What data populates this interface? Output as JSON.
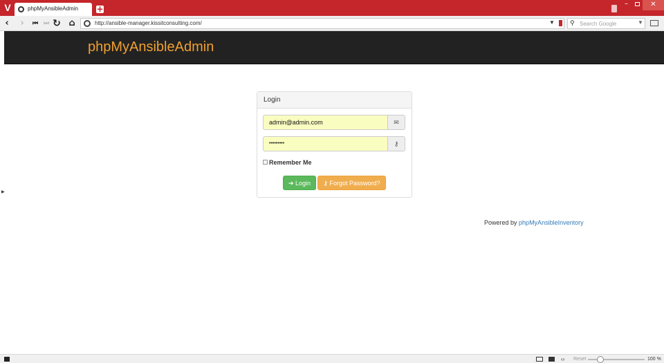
{
  "browser": {
    "tab_title": "phpMyAnsibleAdmin",
    "url": "http://ansible-manager.kissitconsulting.com/",
    "search_placeholder": "Search Google",
    "zoom_level": "100 %",
    "reset_label": "Reset"
  },
  "header": {
    "brand": "phpMyAnsibleAdmin"
  },
  "login_panel": {
    "heading": "Login",
    "email_value": "admin@admin.com",
    "password_mask": "•••••••••",
    "remember_label": "Remember Me",
    "login_button": "Login",
    "forgot_button": "Forgot Password?"
  },
  "footer": {
    "powered_prefix": "Powered by",
    "powered_link": "phpMyAnsibleInventory"
  },
  "colors": {
    "chrome_red": "#c4262b",
    "brand_orange": "#f0a030",
    "navbar": "#222222",
    "success": "#5cb85c",
    "warning": "#f0ad4e",
    "link": "#337ab7",
    "autofill": "#fafdc0"
  },
  "icons": {
    "email_addon": "envelope-icon",
    "password_addon": "key-icon",
    "login_button_icon": "sign-in-icon",
    "forgot_button_icon": "key-icon"
  }
}
